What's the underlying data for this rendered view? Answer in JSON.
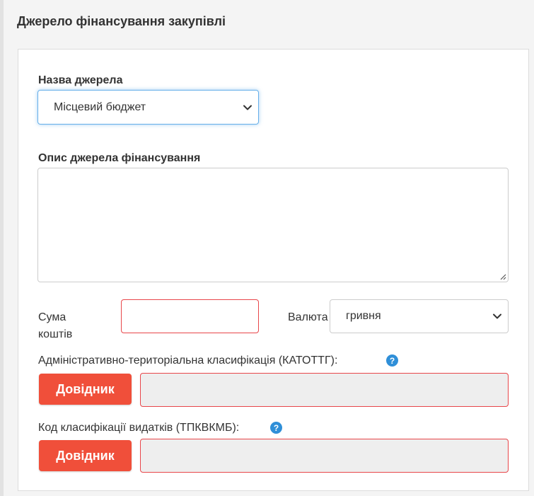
{
  "section": {
    "title": "Джерело фінансування закупівлі"
  },
  "source_name": {
    "label": "Назва джерела",
    "selected": "Місцевий бюджет"
  },
  "description": {
    "label": "Опис джерела фінансування",
    "value": ""
  },
  "amount": {
    "label_line1": "Сума",
    "label_line2": "коштів",
    "value": ""
  },
  "currency": {
    "label": "Валюта",
    "selected": "гривня"
  },
  "katottg": {
    "label": "Адміністративно-територіальна класифікація (КАТОТТГ):",
    "button_label": "Довідник",
    "value": ""
  },
  "tpkvkmb": {
    "label": "Код класифікації видатків (ТПКВКМБ):",
    "button_label": "Довідник",
    "value": ""
  },
  "colors": {
    "accent_button": "#f04f3a",
    "error_border": "#e8464a",
    "focus_border": "#66afe9",
    "help_icon": "#2f8fd8"
  }
}
